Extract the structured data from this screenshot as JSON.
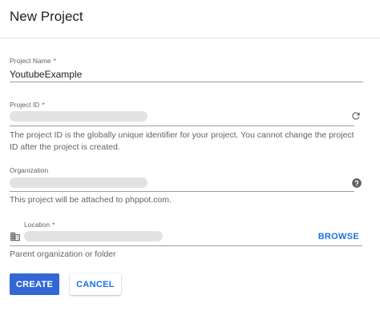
{
  "dialog": {
    "title": "New Project"
  },
  "project_name": {
    "label": "Project Name",
    "required_mark": "*",
    "value": "YoutubeExample"
  },
  "project_id": {
    "label": "Project ID",
    "required_mark": "*",
    "helper": "The project ID is the globally unique identifier for your project. You cannot change the project ID after the project is created.",
    "icon": "refresh-icon"
  },
  "organization": {
    "label": "Organization",
    "helper": "This project will be attached to phppot.com.",
    "icon": "help-icon"
  },
  "location": {
    "label": "Location",
    "required_mark": "*",
    "icon": "building-icon",
    "browse_label": "BROWSE",
    "helper": "Parent organization or folder"
  },
  "actions": {
    "create_label": "CREATE",
    "cancel_label": "CANCEL"
  },
  "colors": {
    "primary": "#3367d6",
    "link": "#1a73e8"
  }
}
